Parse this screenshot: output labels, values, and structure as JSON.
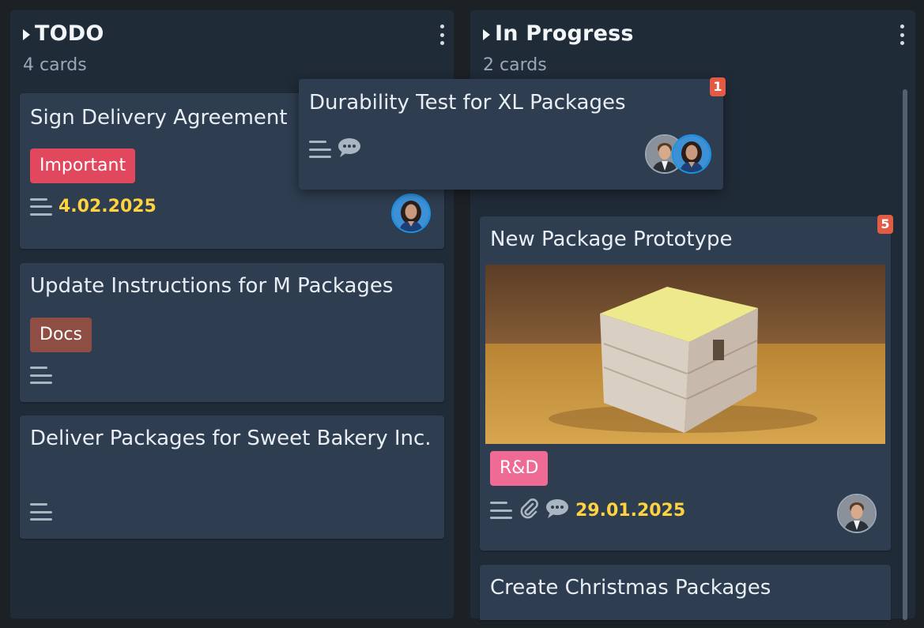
{
  "columns": [
    {
      "title": "TODO",
      "count": "4 cards",
      "cards": [
        {
          "title": "Sign Delivery Agreement",
          "label": "Important",
          "date": "4.02.2025"
        },
        {
          "title": "Update Instructions for M Packages",
          "label": "Docs"
        },
        {
          "title": "Deliver Packages for Sweet Bakery Inc."
        }
      ]
    },
    {
      "title": "In Progress",
      "count": "2 cards",
      "cards": [
        {
          "title": "New Package Prototype",
          "label": "R&D",
          "date": "29.01.2025",
          "badge": "5"
        },
        {
          "title": "Create Christmas Packages"
        }
      ]
    }
  ],
  "dragging_card": {
    "title": "Durability Test for XL Packages",
    "badge": "1"
  },
  "colors": {
    "label_important": "#e2485d",
    "label_docs": "#8e4e43",
    "label_rd": "#f06a96",
    "date": "#ffd23f",
    "badge": "#e25b45",
    "avatar_ring": "#1893e6"
  },
  "icons": [
    "triangle-right-icon",
    "more-vertical-icon",
    "description-lines-icon",
    "comment-icon",
    "paperclip-icon"
  ]
}
